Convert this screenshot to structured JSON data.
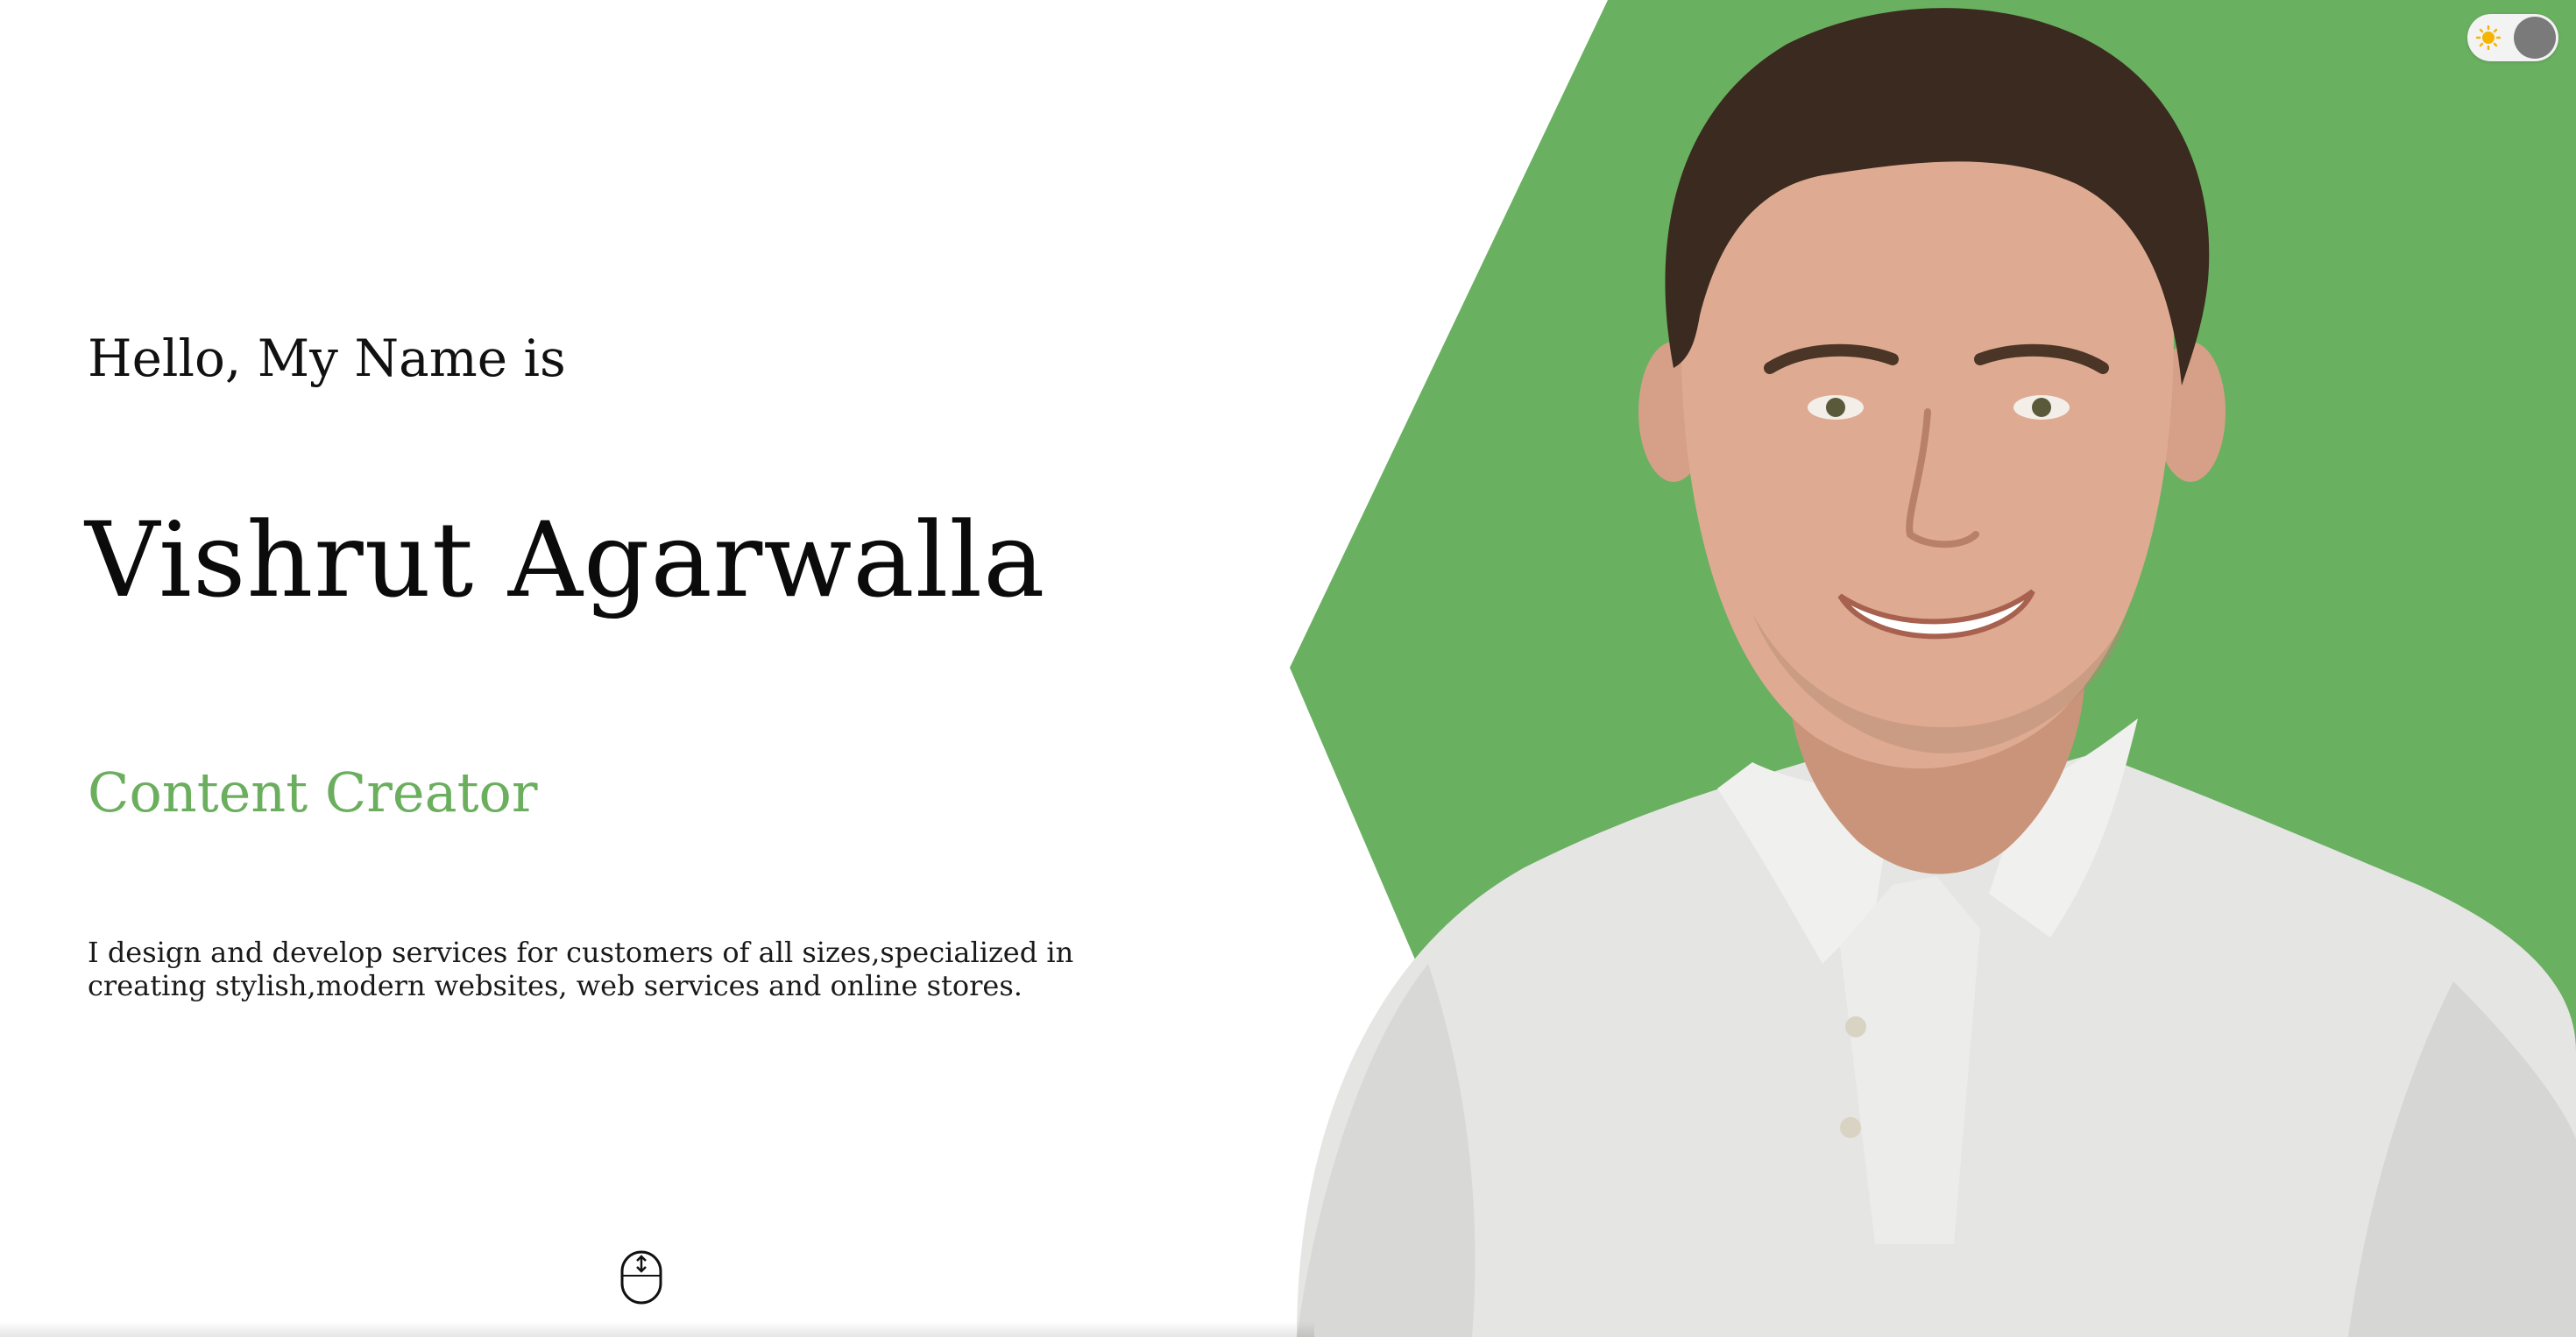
{
  "hero": {
    "greeting": "Hello, My Name is",
    "name": "Vishrut Agarwalla",
    "role": "Content Creator",
    "bio": "I design and develop services for customers of all sizes,specialized in creating stylish,modern websites, web services and online stores.",
    "accent_color": "#6ab061",
    "role_color": "#6aae5e"
  },
  "theme_toggle": {
    "icon": "sun-icon",
    "state": "light"
  },
  "scroll_indicator": {
    "icon": "mouse-scroll-icon"
  },
  "portrait": {
    "icon": "person-photo"
  }
}
